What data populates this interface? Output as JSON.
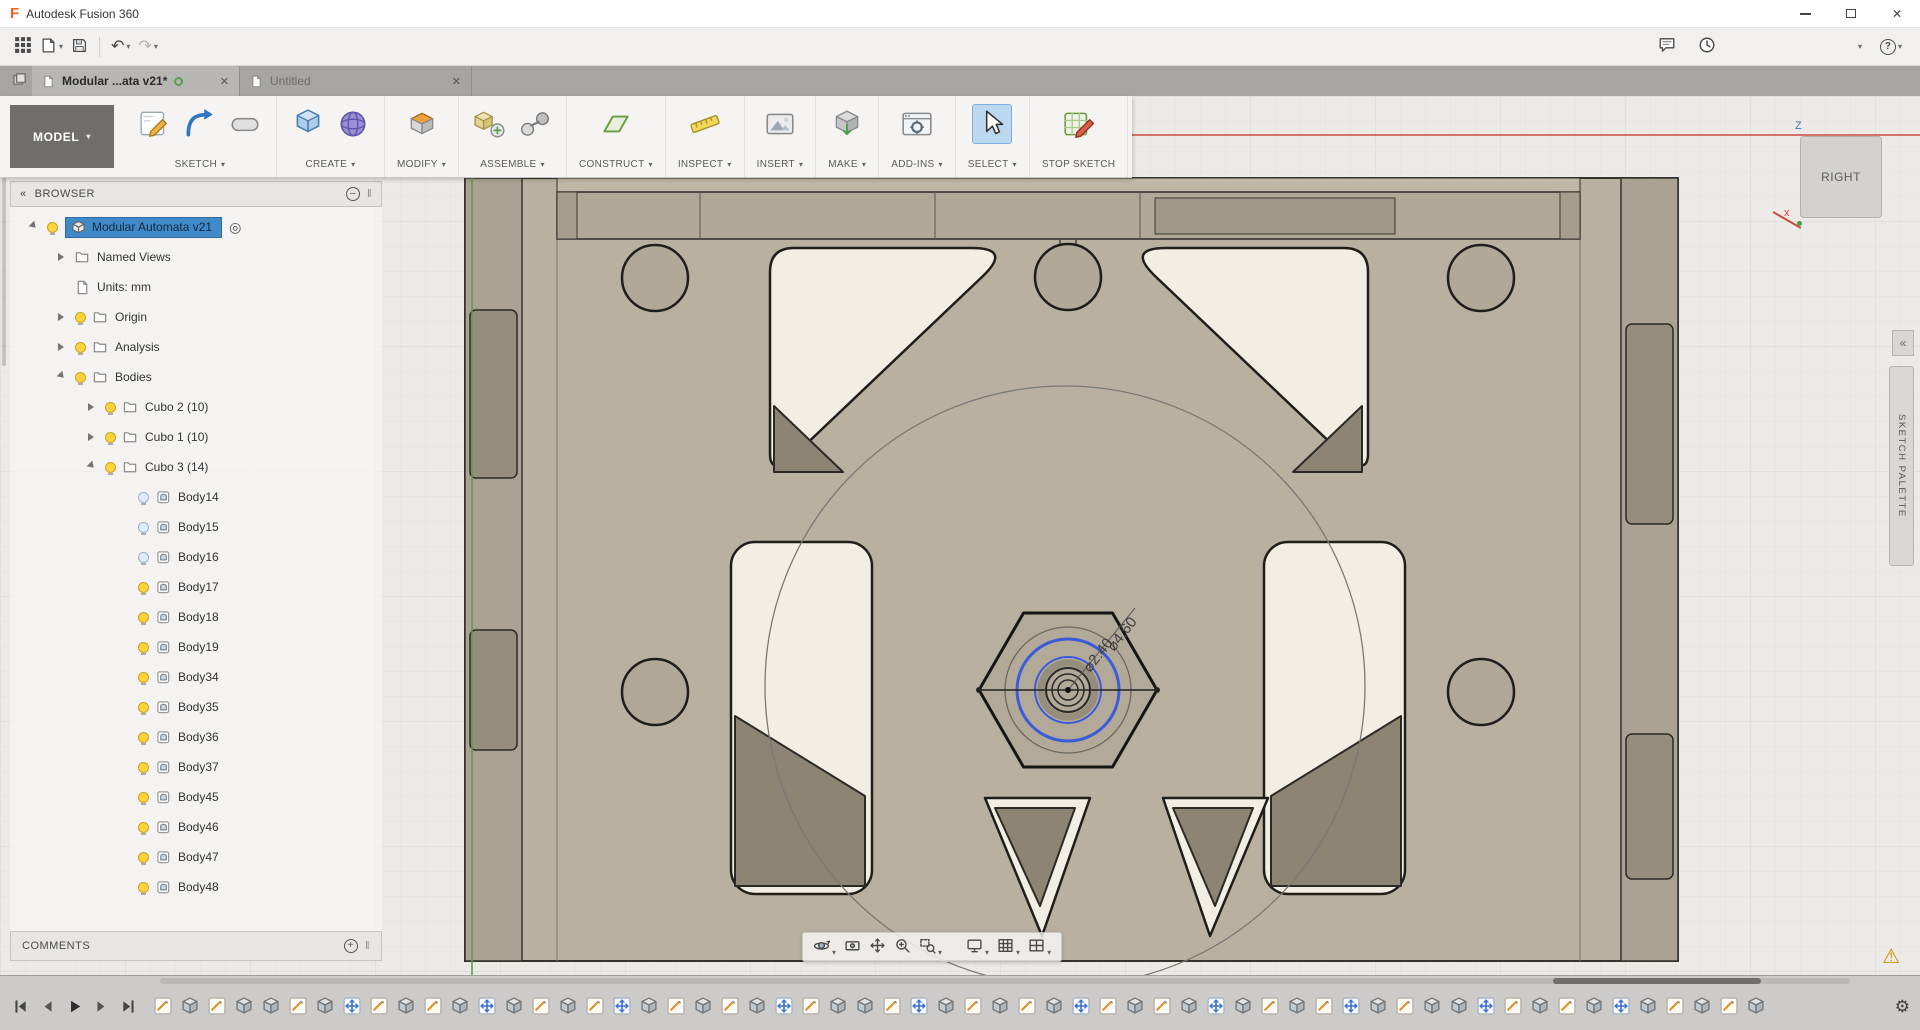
{
  "window": {
    "title": "Autodesk Fusion 360"
  },
  "icons": {
    "close": "✕",
    "caret_down": "▾",
    "collapse_left": "«",
    "target": "◎",
    "warning": "⚠",
    "gear": "⚙",
    "undo": "↶",
    "redo": "↷",
    "help": "?",
    "handle": "‖",
    "minus": "–",
    "plus": "+"
  },
  "tabs": [
    {
      "label": "Modular ...ata v21*",
      "active": true,
      "has_status_ring": true
    },
    {
      "label": "Untitled",
      "active": false,
      "has_status_ring": false
    }
  ],
  "ribbon": {
    "workspace_label": "MODEL",
    "groups": [
      {
        "id": "sketch",
        "label": "SKETCH",
        "caret": true,
        "icons": [
          "sketch-create",
          "sketch-project",
          "sketch-slot"
        ]
      },
      {
        "id": "create",
        "label": "CREATE",
        "caret": true,
        "icons": [
          "create-extrude",
          "create-form"
        ]
      },
      {
        "id": "modify",
        "label": "MODIFY",
        "caret": true,
        "icons": [
          "modify-presspull"
        ]
      },
      {
        "id": "assemble",
        "label": "ASSEMBLE",
        "caret": true,
        "icons": [
          "assemble-component",
          "assemble-joint"
        ]
      },
      {
        "id": "construct",
        "label": "CONSTRUCT",
        "caret": true,
        "icons": [
          "construct-plane"
        ]
      },
      {
        "id": "inspect",
        "label": "INSPECT",
        "caret": true,
        "icons": [
          "inspect-measure"
        ]
      },
      {
        "id": "insert",
        "label": "INSERT",
        "caret": true,
        "icons": [
          "insert-image"
        ]
      },
      {
        "id": "make",
        "label": "MAKE",
        "caret": true,
        "icons": [
          "make-3dprint"
        ]
      },
      {
        "id": "addins",
        "label": "ADD-INS",
        "caret": true,
        "icons": [
          "addins-scripts"
        ]
      },
      {
        "id": "select",
        "label": "SELECT",
        "caret": true,
        "icons": [
          "select-cursor"
        ],
        "selected": true
      },
      {
        "id": "stop-sketch",
        "label": "STOP SKETCH",
        "caret": false,
        "icons": [
          "stop-sketch"
        ]
      }
    ]
  },
  "browser": {
    "header": "BROWSER",
    "comments_label": "COMMENTS",
    "root": {
      "label": "Modular Automata v21",
      "selected": true
    },
    "items": [
      {
        "label": "Named Views",
        "level": 1,
        "icon": "folder",
        "expander": "collapsed"
      },
      {
        "label": "Units: mm",
        "level": 1,
        "icon": "document"
      },
      {
        "label": "Origin",
        "level": 1,
        "icon": "folder",
        "bulb": "on",
        "expander": "collapsed"
      },
      {
        "label": "Analysis",
        "level": 1,
        "icon": "folder",
        "bulb": "on",
        "expander": "collapsed"
      },
      {
        "label": "Bodies",
        "level": 1,
        "icon": "folder",
        "bulb": "on",
        "expander": "expanded"
      },
      {
        "label": "Cubo 2 (10)",
        "level": 2,
        "icon": "folder",
        "bulb": "on",
        "expander": "collapsed"
      },
      {
        "label": "Cubo 1 (10)",
        "level": 2,
        "icon": "folder",
        "bulb": "on",
        "expander": "collapsed"
      },
      {
        "label": "Cubo 3 (14)",
        "level": 2,
        "icon": "folder",
        "bulb": "on",
        "expander": "expanded"
      },
      {
        "label": "Body14",
        "level": 3,
        "icon": "body",
        "bulb": "off"
      },
      {
        "label": "Body15",
        "level": 3,
        "icon": "body",
        "bulb": "off"
      },
      {
        "label": "Body16",
        "level": 3,
        "icon": "body",
        "bulb": "off"
      },
      {
        "label": "Body17",
        "level": 3,
        "icon": "body",
        "bulb": "on"
      },
      {
        "label": "Body18",
        "level": 3,
        "icon": "body",
        "bulb": "on"
      },
      {
        "label": "Body19",
        "level": 3,
        "icon": "body",
        "bulb": "on"
      },
      {
        "label": "Body34",
        "level": 3,
        "icon": "body",
        "bulb": "on"
      },
      {
        "label": "Body35",
        "level": 3,
        "icon": "body",
        "bulb": "on"
      },
      {
        "label": "Body36",
        "level": 3,
        "icon": "body",
        "bulb": "on"
      },
      {
        "label": "Body37",
        "level": 3,
        "icon": "body",
        "bulb": "on"
      },
      {
        "label": "Body45",
        "level": 3,
        "icon": "body",
        "bulb": "on"
      },
      {
        "label": "Body46",
        "level": 3,
        "icon": "body",
        "bulb": "on"
      },
      {
        "label": "Body47",
        "level": 3,
        "icon": "body",
        "bulb": "on"
      },
      {
        "label": "Body48",
        "level": 3,
        "icon": "body",
        "bulb": "on"
      }
    ]
  },
  "canvas": {
    "viewcube_face": "RIGHT",
    "axis_labels": {
      "z": "Z",
      "x": "x"
    },
    "sketch_palette_label": "SKETCH PALETTE",
    "dimensions": {
      "outer": "⌀4.60",
      "inner": "⌀2.40"
    }
  },
  "navbar": {
    "items": [
      {
        "icon": "orbit",
        "caret": true
      },
      {
        "icon": "look-at",
        "caret": false
      },
      {
        "icon": "pan",
        "caret": false
      },
      {
        "icon": "zoom",
        "caret": false
      },
      {
        "icon": "zoom-window",
        "caret": true
      },
      {
        "icon": "display-settings",
        "caret": true
      },
      {
        "icon": "grid-settings",
        "caret": true
      },
      {
        "icon": "viewports",
        "caret": true
      }
    ]
  },
  "timeline": {
    "playback": [
      "go-to-start",
      "step-back",
      "play",
      "step-forward",
      "go-to-end"
    ],
    "items": [
      "sketch",
      "extrude",
      "sketch",
      "extrude",
      "extrude",
      "sketch",
      "extrude",
      "move",
      "sketch",
      "extrude",
      "sketch",
      "extrude",
      "move",
      "extrude",
      "sketch",
      "extrude",
      "sketch",
      "move",
      "extrude",
      "sketch",
      "extrude",
      "sketch",
      "extrude",
      "move",
      "sketch",
      "extrude",
      "extrude",
      "sketch",
      "move",
      "extrude",
      "sketch",
      "extrude",
      "sketch",
      "extrude",
      "move",
      "sketch",
      "extrude",
      "sketch",
      "extrude",
      "move",
      "extrude",
      "sketch",
      "extrude",
      "sketch",
      "move",
      "extrude",
      "sketch",
      "extrude",
      "extrude",
      "move",
      "sketch",
      "extrude",
      "sketch",
      "extrude",
      "move",
      "extrude",
      "sketch",
      "extrude",
      "sketch",
      "extrude"
    ]
  }
}
